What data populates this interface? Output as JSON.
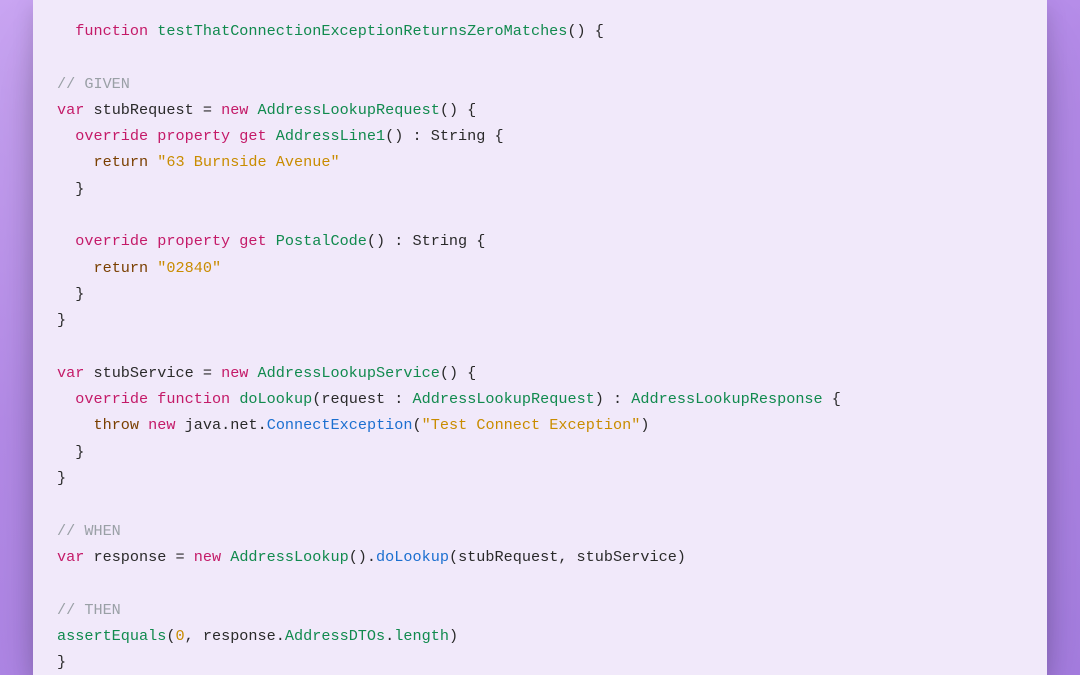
{
  "code": {
    "l1_kw": "function",
    "l1_fn": "testThatConnectionExceptionReturnsZeroMatches",
    "l1_tail": "() {",
    "l3_cmt": "// GIVEN",
    "l4_kw": "var",
    "l4_var": "stubRequest",
    "l4_eq": " = ",
    "l4_kw2": "new",
    "l4_fn": "AddressLookupRequest",
    "l4_tail": "() {",
    "l5_pre": "  ",
    "l5_kw": "override property get",
    "l5_fn": "AddressLine1",
    "l5_tail": "() : String {",
    "l6_pre": "    ",
    "l6_ret": "return",
    "l6_str": "\"63 Burnside Avenue\"",
    "l7_pre": "  }",
    "l9_pre": "  ",
    "l9_kw": "override property get",
    "l9_fn": "PostalCode",
    "l9_tail": "() : String {",
    "l10_pre": "    ",
    "l10_ret": "return",
    "l10_str": "\"02840\"",
    "l11_pre": "  }",
    "l12": "}",
    "l14_kw": "var",
    "l14_var": "stubService",
    "l14_eq": " = ",
    "l14_kw2": "new",
    "l14_fn": "AddressLookupService",
    "l14_tail": "() {",
    "l15_pre": "  ",
    "l15_kw": "override function",
    "l15_fn": "doLookup",
    "l15_open": "(",
    "l15_p1": "request",
    "l15_sep": " : ",
    "l15_t1": "AddressLookupRequest",
    "l15_close": ") : ",
    "l15_t2": "AddressLookupResponse",
    "l15_brace": " {",
    "l16_pre": "    ",
    "l16_ret": "throw",
    "l16_kw2": "new",
    "l16_ns1": "java",
    "l16_dot": ".",
    "l16_ns2": "net",
    "l16_ex": "ConnectException",
    "l16_open": "(",
    "l16_str": "\"Test Connect Exception\"",
    "l16_close": ")",
    "l17_pre": "  }",
    "l18": "}",
    "l20_cmt": "// WHEN",
    "l21_kw": "var",
    "l21_var": "response",
    "l21_eq": " = ",
    "l21_kw2": "new",
    "l21_fn": "AddressLookup",
    "l21_open": "().",
    "l21_call": "doLookup",
    "l21_args": "(stubRequest, stubService)",
    "l23_cmt": "// THEN",
    "l24_fn": "assertEquals",
    "l24_open": "(",
    "l24_num": "0",
    "l24_sep": ", response.",
    "l24_p1": "AddressDTOs",
    "l24_dot": ".",
    "l24_p2": "length",
    "l24_close": ")",
    "l25": "}"
  }
}
